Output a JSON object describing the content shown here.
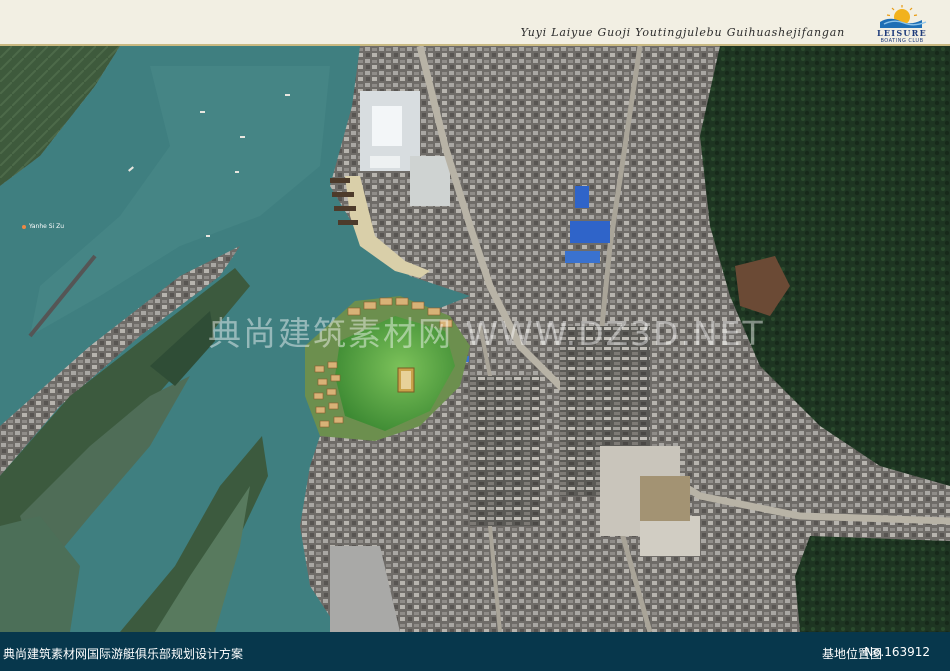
{
  "header": {
    "pinyin_title": "Yuyi Laiyue Guoji Youtingjulebu Guihuashejifangan",
    "logo_name": "LEISURE",
    "logo_sub": "BOATING CLUB"
  },
  "map": {
    "place_label": "Yanhe Si Zu",
    "watermark": "典尚建筑素材网 WWW.DZ3D.NET"
  },
  "footer": {
    "left_text": "典尚建筑素材网国际游艇俱乐部规划设计方案",
    "right_text": "基地位置图",
    "number": "No.163912"
  },
  "colors": {
    "header_bg": "#f2efe3",
    "footer_bg": "#07374c",
    "river": "#3f7f80",
    "forest": "#1f3a23",
    "site_green": "#4a9a3b"
  }
}
